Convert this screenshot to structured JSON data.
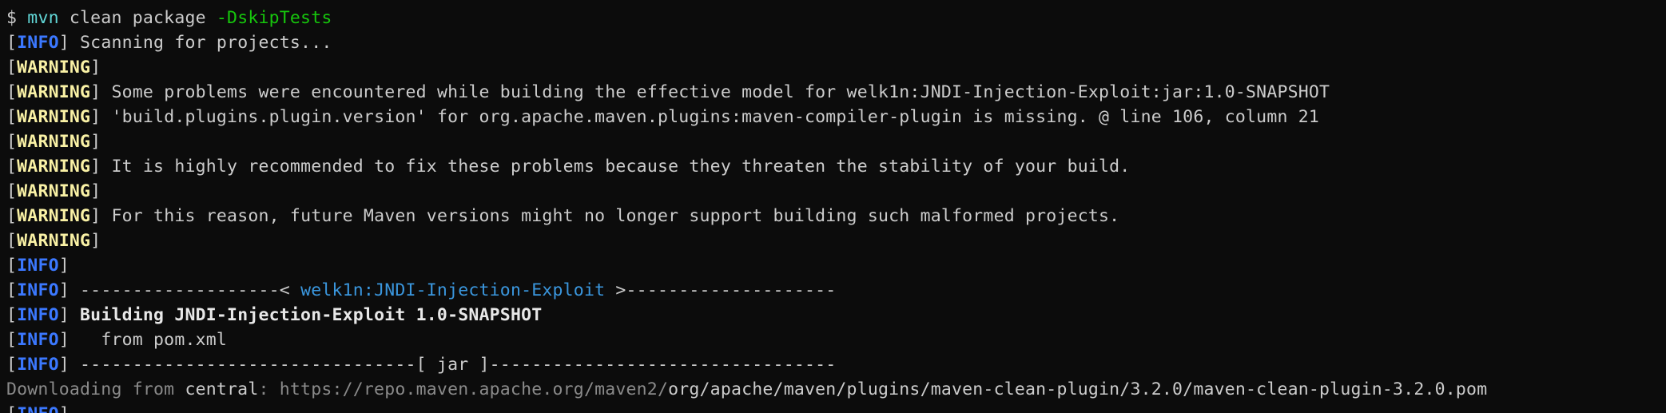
{
  "terminal": {
    "prompt": "$ ",
    "command": {
      "program": "mvn",
      "args": " clean package ",
      "flag": "-DskipTests"
    },
    "tags": {
      "info": "INFO",
      "warning": "WARNING",
      "open": "[",
      "close": "]"
    },
    "lines": {
      "scanning": " Scanning for projects...",
      "warn_problems": " Some problems were encountered while building the effective model for welk1n:JNDI-Injection-Exploit:jar:1.0-SNAPSHOT",
      "warn_plugin_version": " 'build.plugins.plugin.version' for org.apache.maven.plugins:maven-compiler-plugin is missing. @ line 106, column 21",
      "warn_recommend": " It is highly recommended to fix these problems because they threaten the stability of your build.",
      "warn_future": " For this reason, future Maven versions might no longer support building such malformed projects.",
      "sep_left": " -------------------< ",
      "artifact": "welk1n:JNDI-Injection-Exploit",
      "sep_right": " >--------------------",
      "building": " Building JNDI-Injection-Exploit 1.0-SNAPSHOT",
      "from_pom": "   from pom.xml",
      "jar_line": " --------------------------------[ jar ]---------------------------------",
      "downloading_label": "Downloading from ",
      "downloading_repo": "central",
      "downloading_sep": ": ",
      "downloading_base": "https://repo.maven.apache.org/maven2/",
      "downloading_path": "org/apache/maven/plugins/maven-clean-plugin/3.2.0/maven-clean-plugin-3.2.0.pom"
    }
  }
}
